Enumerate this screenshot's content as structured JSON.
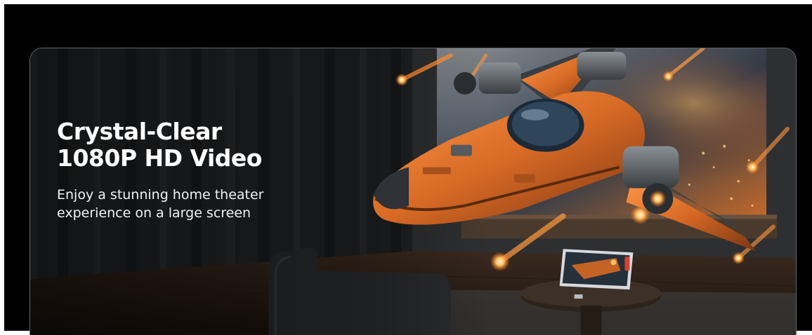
{
  "banner": {
    "headline_line1": "Crystal-Clear",
    "headline_highlight": "1080P HD",
    "headline_line2_rest": " Video",
    "subcopy": "Enjoy a stunning home theater experience on a large screen",
    "highlight_color": "#f3c46a"
  },
  "hero_image": {
    "icon": "spaceship-projection-scene"
  }
}
